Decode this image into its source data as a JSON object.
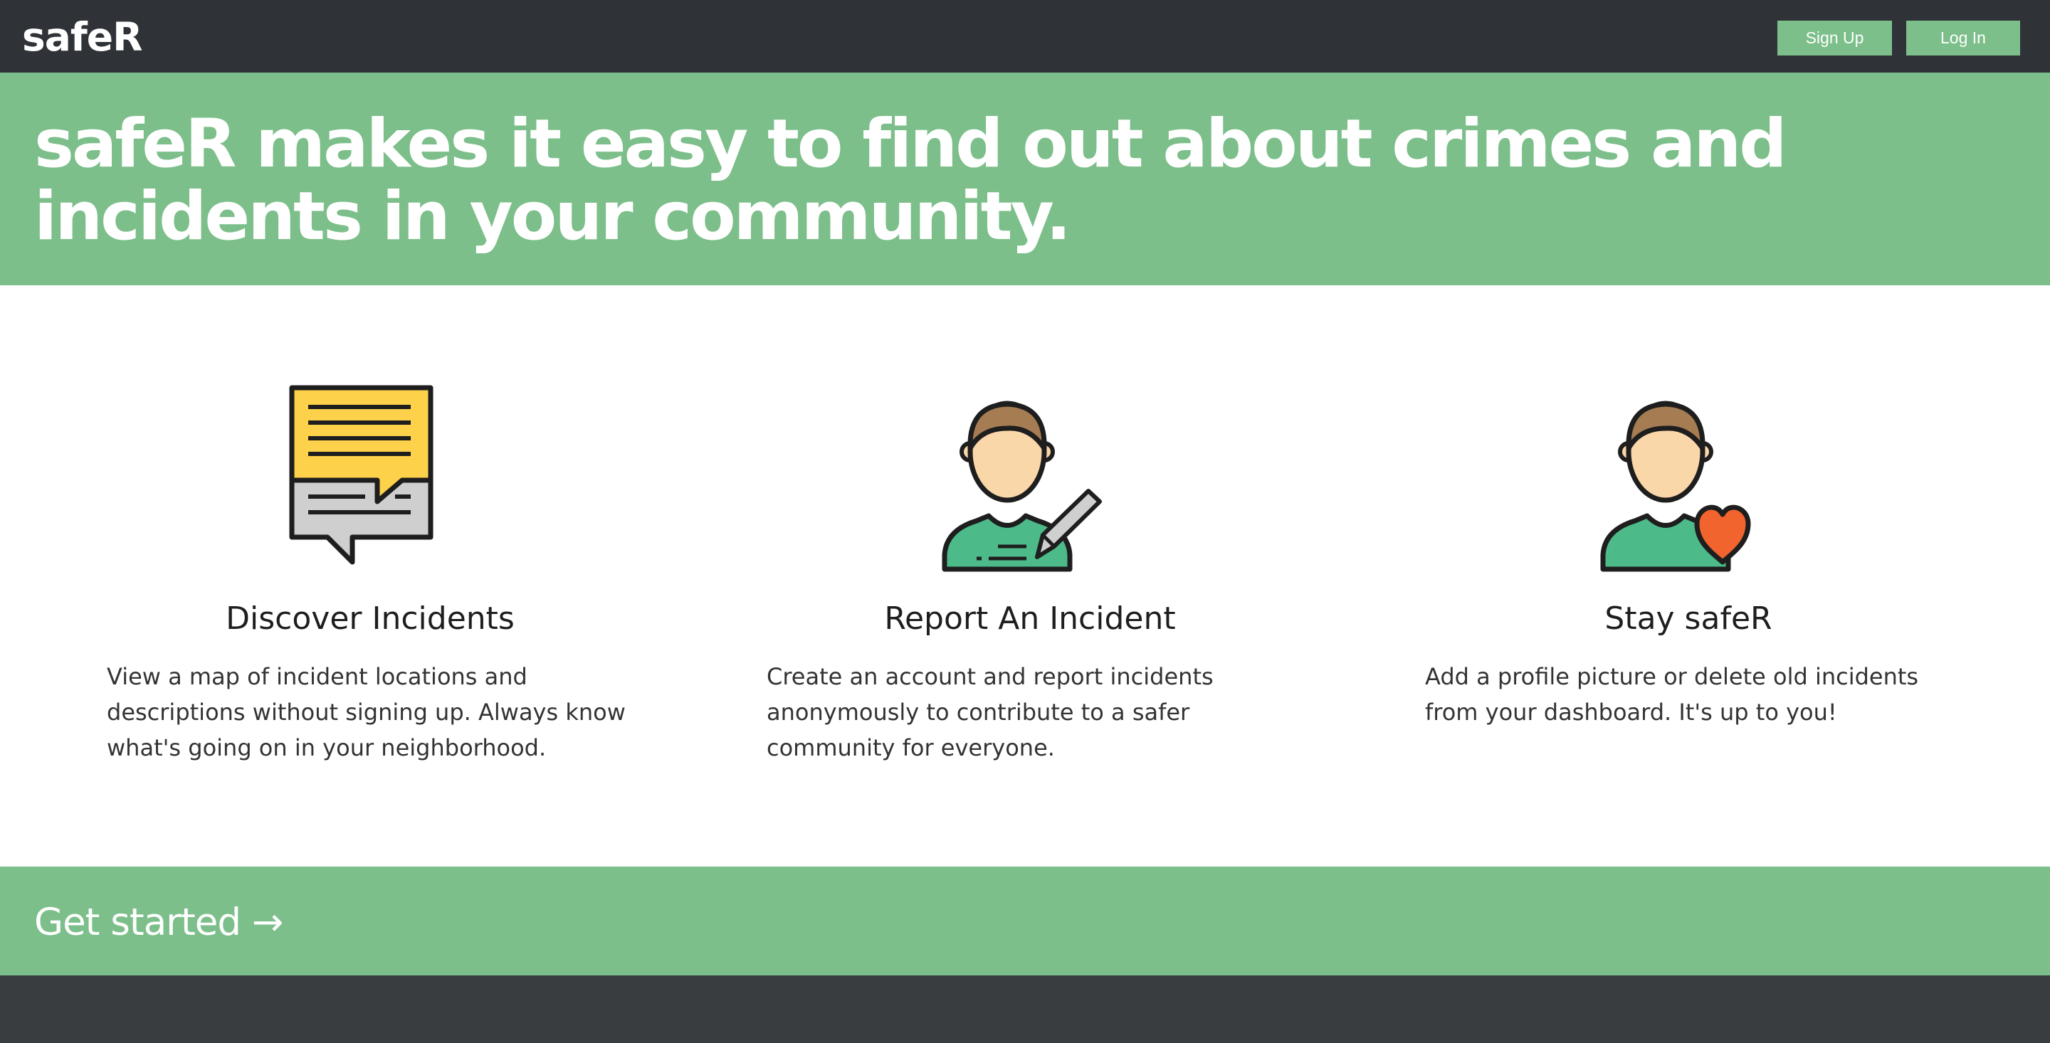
{
  "header": {
    "brand": "safeR",
    "signup_label": "Sign Up",
    "login_label": "Log In"
  },
  "hero": {
    "title": "safeR makes it easy to find out about crimes and incidents in your community."
  },
  "features": [
    {
      "icon": "chat-bubbles-icon",
      "title": "Discover Incidents",
      "description": "View a map of incident locations and descriptions without signing up. Always know what's going on in your neighborhood."
    },
    {
      "icon": "person-with-pencil-icon",
      "title": "Report An Incident",
      "description": "Create an account and report incidents anonymously to contribute to a safer community for everyone."
    },
    {
      "icon": "person-with-heart-icon",
      "title": "Stay safeR",
      "description": "Add a profile picture or delete old incidents from your dashboard. It's up to you!"
    }
  ],
  "cta": {
    "label": "Get started →"
  },
  "colors": {
    "nav_bg": "#2f3337",
    "accent_green": "#7cbf8a",
    "footer_bg": "#393d40",
    "icon_yellow": "#fdd14a",
    "icon_gray": "#cfcfcf",
    "skin": "#fad7a8",
    "hair": "#a67c52",
    "shirt": "#4dba8a",
    "heart": "#f1642e"
  }
}
